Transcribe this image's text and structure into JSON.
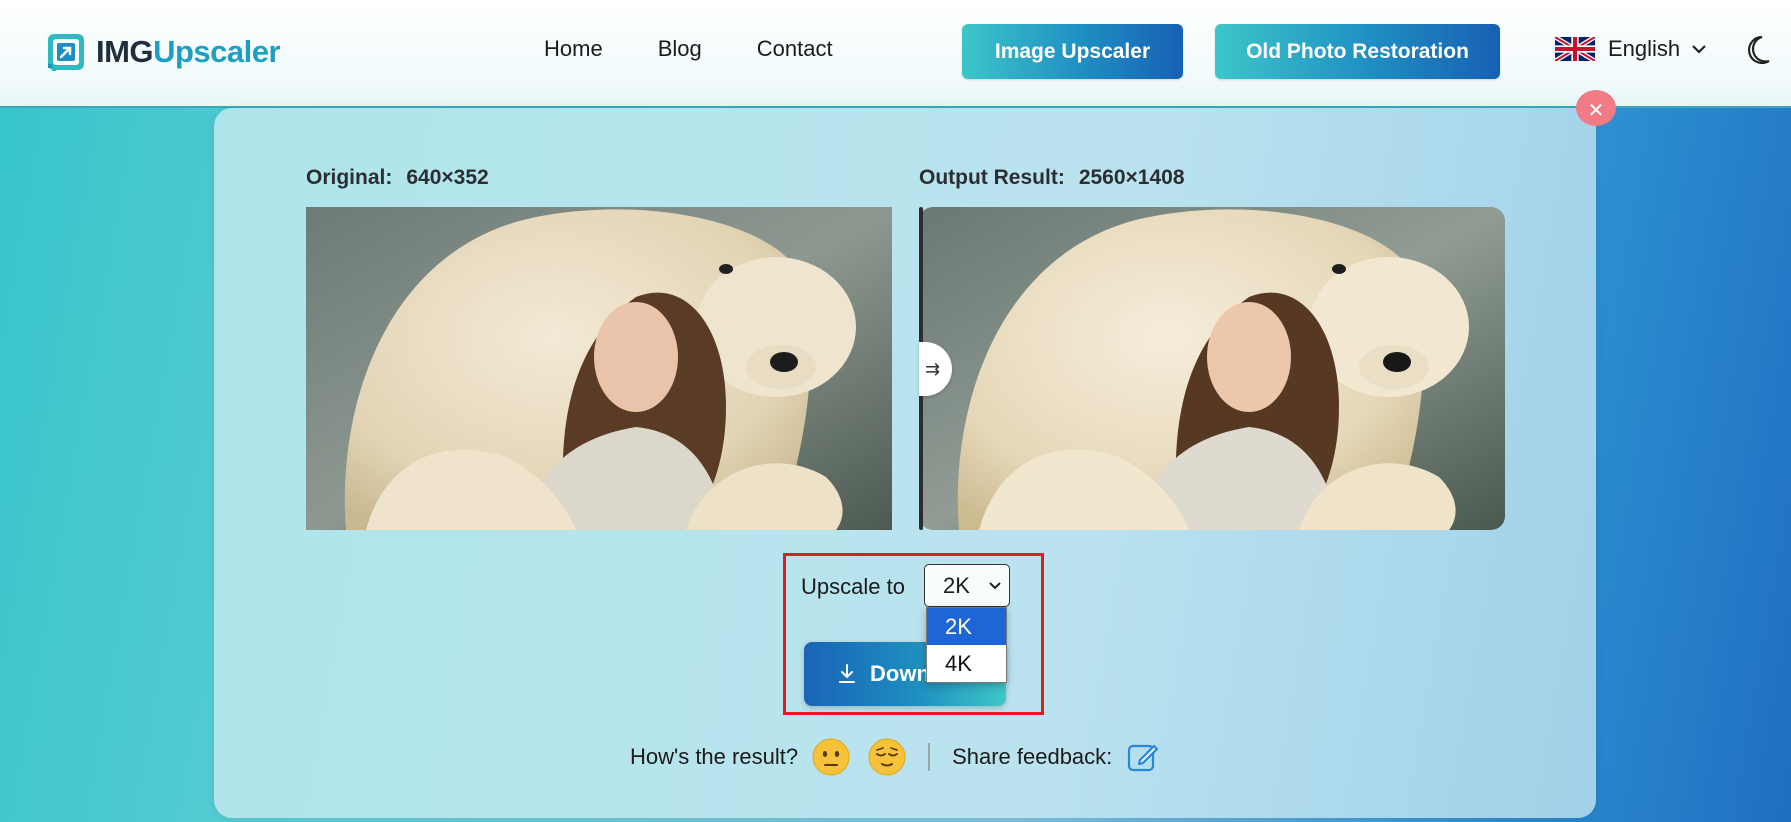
{
  "header": {
    "logo_part1": "IMG",
    "logo_part2": "Upscaler",
    "nav": [
      "Home",
      "Blog",
      "Contact"
    ],
    "btn_upscaler": "Image Upscaler",
    "btn_restore": "Old Photo Restoration",
    "language": "English",
    "icons": {
      "logo": "logo-icon",
      "flag": "uk-flag-icon",
      "chevron": "chevron-down-icon",
      "theme": "moon-icon"
    }
  },
  "compare": {
    "original_label": "Original:",
    "original_size": "640×352",
    "output_label": "Output Result:",
    "output_size": "2560×1408",
    "slider_icon": "⇉"
  },
  "controls": {
    "upscale_label": "Upscale to",
    "selected": "2K",
    "options": [
      "2K",
      "4K"
    ],
    "download_label": "Down"
  },
  "feedback": {
    "question": "How's the result?",
    "share_label": "Share feedback:"
  },
  "colors": {
    "accent_teal": "#3cc6c9",
    "accent_blue": "#1760b3",
    "highlight_red": "#e01b24",
    "option_active": "#1e65d6"
  }
}
